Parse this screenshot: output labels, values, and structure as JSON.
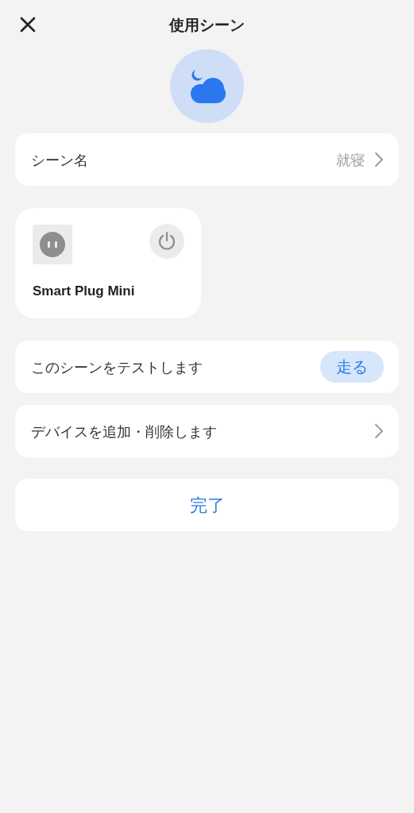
{
  "header": {
    "title": "使用シーン"
  },
  "scene_name": {
    "label": "シーン名",
    "value": "就寝"
  },
  "devices": [
    {
      "name": "Smart Plug Mini",
      "on": false
    }
  ],
  "rows": [
    {
      "kind": "button",
      "label": "このシーンをテストします",
      "button": "走る"
    },
    {
      "kind": "link",
      "label": "デバイスを追加・削除します"
    }
  ],
  "done_button": "完了"
}
